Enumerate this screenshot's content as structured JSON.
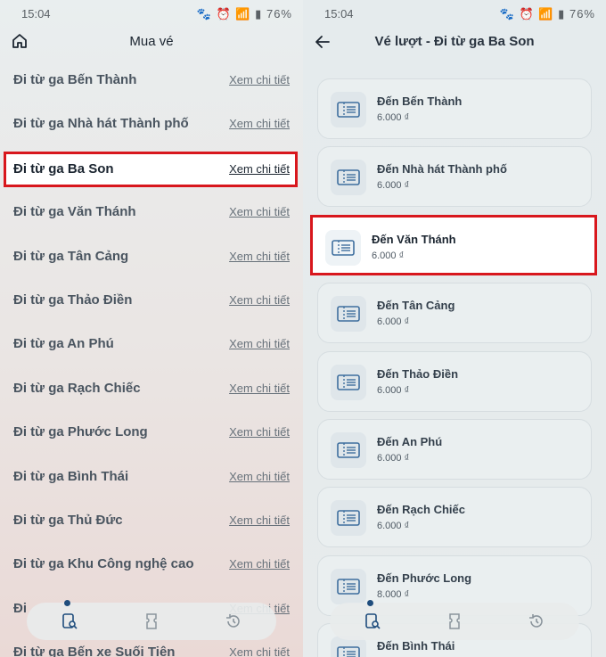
{
  "status": {
    "time": "15:04",
    "battery": "76%",
    "icons": "🐾 ⏰ 📶 ▮"
  },
  "left": {
    "title": "Mua vé",
    "link_label": "Xem chi tiết",
    "stations": [
      "Đi từ ga Bến Thành",
      "Đi từ ga Nhà hát Thành phố",
      "Đi từ ga Ba Son",
      "Đi từ ga Văn Thánh",
      "Đi từ ga Tân Cảng",
      "Đi từ ga Thảo Điền",
      "Đi từ ga An Phú",
      "Đi từ ga Rạch Chiếc",
      "Đi từ ga Phước Long",
      "Đi từ ga Bình Thái",
      "Đi từ ga Thủ Đức",
      "Đi từ ga Khu Công nghệ cao",
      "Đi",
      "Đi từ ga Bến xe Suối Tiên"
    ],
    "selected_index": 2
  },
  "right": {
    "title": "Vé lượt - Đi từ ga Ba Son",
    "tickets": [
      {
        "name": "Đến Bến Thành",
        "price": "6.000 ₫"
      },
      {
        "name": "Đến Nhà hát Thành phố",
        "price": "6.000 ₫"
      },
      {
        "name": "Đến Văn Thánh",
        "price": "6.000 ₫"
      },
      {
        "name": "Đến Tân Cảng",
        "price": "6.000 ₫"
      },
      {
        "name": "Đến Thảo Điền",
        "price": "6.000 ₫"
      },
      {
        "name": "Đến An Phú",
        "price": "6.000 ₫"
      },
      {
        "name": "Đến Rạch Chiếc",
        "price": "6.000 ₫"
      },
      {
        "name": "Đến Phước Long",
        "price": "8.000 ₫"
      },
      {
        "name": "Đến Bình Thái",
        "price": ""
      }
    ],
    "selected_index": 2
  },
  "bottom_nav": [
    "ticket-search-icon",
    "ticket-icon",
    "history-icon"
  ],
  "colors": {
    "highlight": "#d8171d",
    "accent": "#1f4d7d"
  }
}
